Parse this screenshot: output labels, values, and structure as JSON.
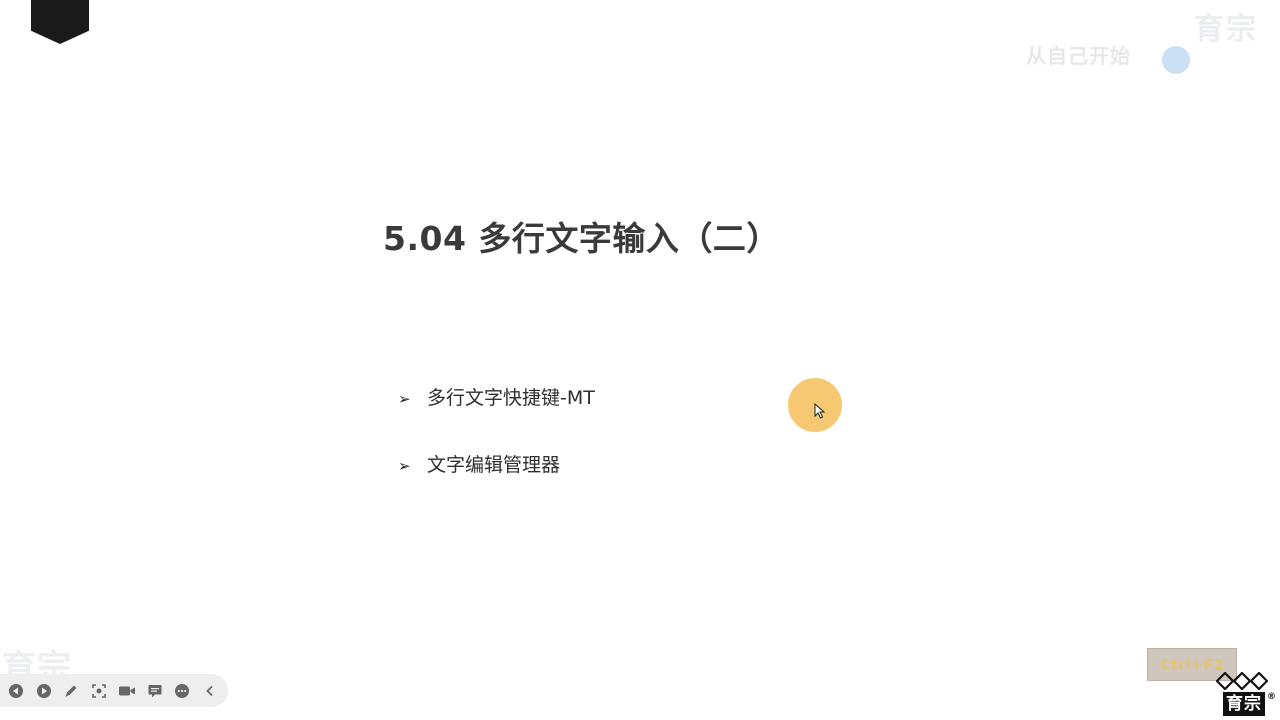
{
  "slide": {
    "title": "5.04  多行文字输入（二）",
    "bullets": [
      {
        "text": "多行文字快捷键-MT"
      },
      {
        "text": "文字编辑管理器"
      }
    ]
  },
  "watermarks": {
    "top_right_big": "育宗",
    "top_right_small": "从自己开始",
    "bottom_left": "育宗"
  },
  "key_badge": "Ctrl+F2",
  "logo": {
    "text": "育宗",
    "mark": "®"
  },
  "toolbar": {
    "buttons": [
      {
        "name": "previous-slide-icon"
      },
      {
        "name": "next-slide-icon"
      },
      {
        "name": "pen-icon"
      },
      {
        "name": "zoom-icon"
      },
      {
        "name": "camera-icon"
      },
      {
        "name": "subtitle-icon"
      },
      {
        "name": "more-options-icon"
      },
      {
        "name": "collapse-toolbar-icon"
      }
    ]
  },
  "colors": {
    "title_text": "#3a3a3a",
    "cursor_highlight": "#f5c56a",
    "corner_tab": "#1a1a1a"
  }
}
